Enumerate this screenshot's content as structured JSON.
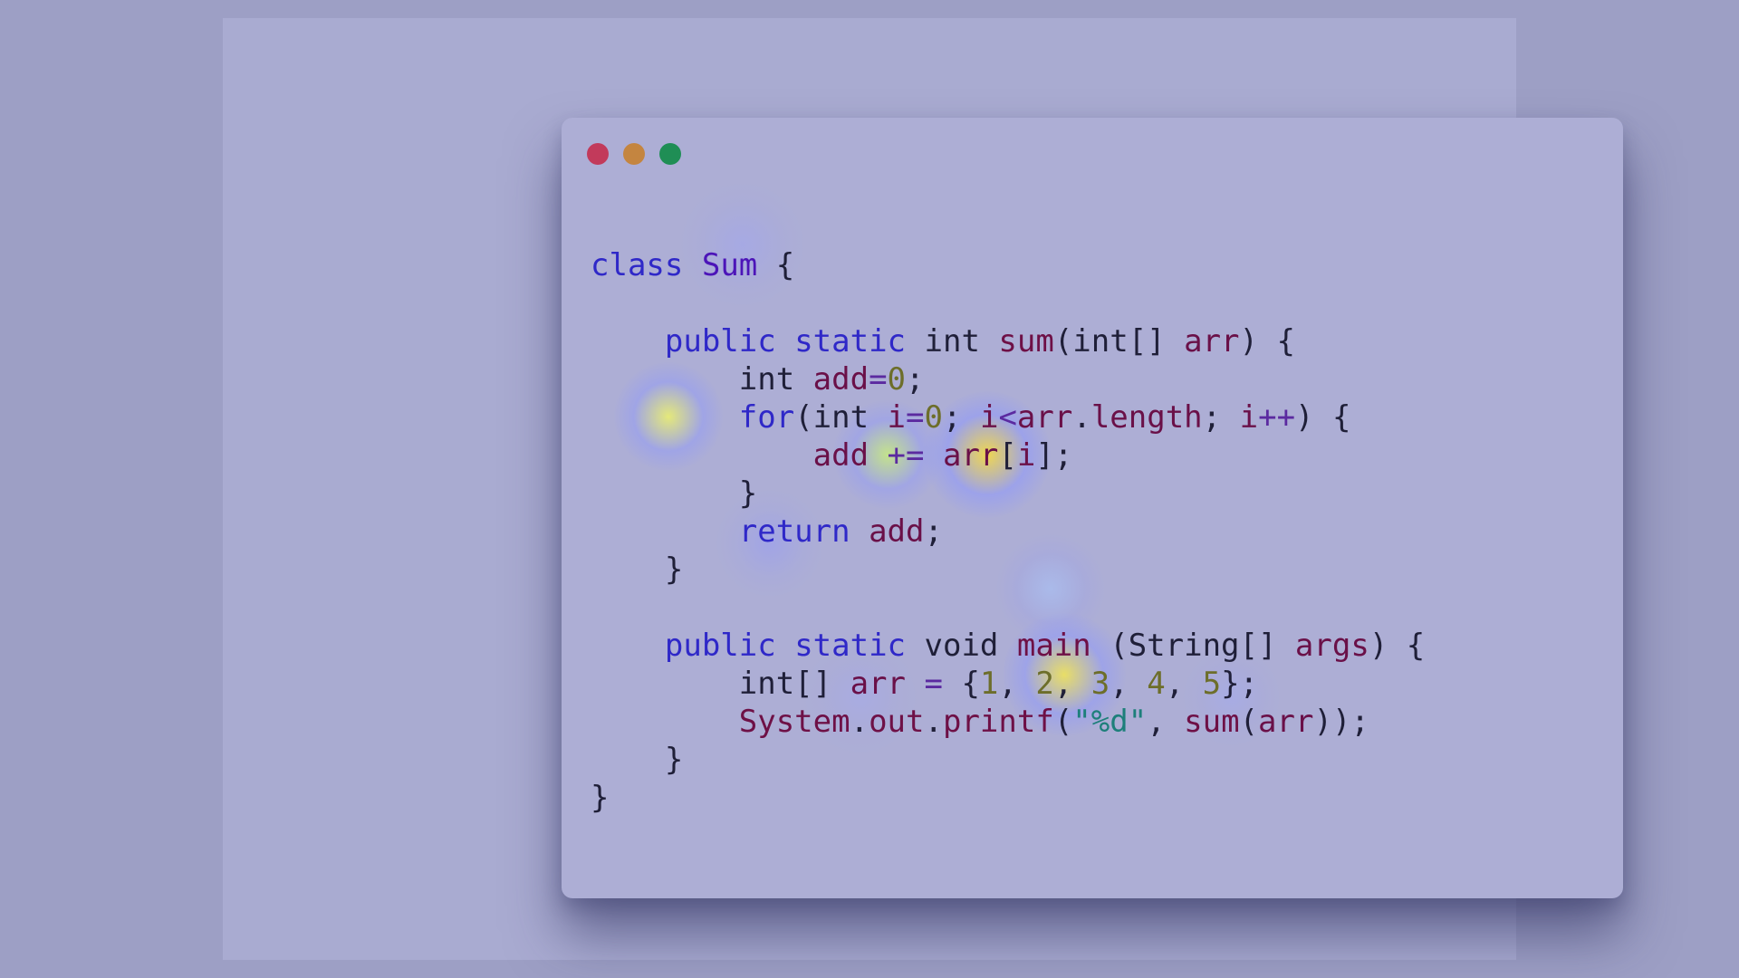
{
  "window": {
    "controls": [
      {
        "name": "close-button",
        "color": "#c23a5b"
      },
      {
        "name": "minimize-button",
        "color": "#c48540"
      },
      {
        "name": "maximize-button",
        "color": "#1f8e55"
      }
    ]
  },
  "code": {
    "lines": [
      [
        [
          "kw",
          "class"
        ],
        [
          "pl",
          " "
        ],
        [
          "cls",
          "Sum"
        ],
        [
          "pl",
          " {"
        ]
      ],
      [],
      [
        [
          "pl",
          "    "
        ],
        [
          "kw",
          "public"
        ],
        [
          "pl",
          " "
        ],
        [
          "kw",
          "static"
        ],
        [
          "pl",
          " int "
        ],
        [
          "fn",
          "sum"
        ],
        [
          "pl",
          "(int[] "
        ],
        [
          "id",
          "arr"
        ],
        [
          "pl",
          ") {"
        ]
      ],
      [
        [
          "pl",
          "        int "
        ],
        [
          "id",
          "add"
        ],
        [
          "op",
          "="
        ],
        [
          "num",
          "0"
        ],
        [
          "pl",
          ";"
        ]
      ],
      [
        [
          "pl",
          "        "
        ],
        [
          "kw",
          "for"
        ],
        [
          "pl",
          "(int "
        ],
        [
          "id",
          "i"
        ],
        [
          "op",
          "="
        ],
        [
          "num",
          "0"
        ],
        [
          "pl",
          "; "
        ],
        [
          "id",
          "i"
        ],
        [
          "op",
          "<"
        ],
        [
          "id",
          "arr"
        ],
        [
          "pl",
          "."
        ],
        [
          "id",
          "length"
        ],
        [
          "pl",
          "; "
        ],
        [
          "id",
          "i"
        ],
        [
          "op",
          "++"
        ],
        [
          "pl",
          ") {"
        ]
      ],
      [
        [
          "pl",
          "            "
        ],
        [
          "id",
          "add"
        ],
        [
          "pl",
          " "
        ],
        [
          "op",
          "+="
        ],
        [
          "pl",
          " "
        ],
        [
          "id",
          "arr"
        ],
        [
          "pl",
          "["
        ],
        [
          "id",
          "i"
        ],
        [
          "pl",
          "];"
        ]
      ],
      [
        [
          "pl",
          "        }"
        ]
      ],
      [
        [
          "pl",
          "        "
        ],
        [
          "kw",
          "return"
        ],
        [
          "pl",
          " "
        ],
        [
          "id",
          "add"
        ],
        [
          "pl",
          ";"
        ]
      ],
      [
        [
          "pl",
          "    }"
        ]
      ],
      [],
      [
        [
          "pl",
          "    "
        ],
        [
          "kw",
          "public"
        ],
        [
          "pl",
          " "
        ],
        [
          "kw",
          "static"
        ],
        [
          "pl",
          " void "
        ],
        [
          "fn",
          "main"
        ],
        [
          "pl",
          " (String[] "
        ],
        [
          "id",
          "args"
        ],
        [
          "pl",
          ") {"
        ]
      ],
      [
        [
          "pl",
          "        int[] "
        ],
        [
          "id",
          "arr"
        ],
        [
          "pl",
          " "
        ],
        [
          "op",
          "="
        ],
        [
          "pl",
          " {"
        ],
        [
          "num",
          "1"
        ],
        [
          "pl",
          ", "
        ],
        [
          "num",
          "2"
        ],
        [
          "pl",
          ", "
        ],
        [
          "num",
          "3"
        ],
        [
          "pl",
          ", "
        ],
        [
          "num",
          "4"
        ],
        [
          "pl",
          ", "
        ],
        [
          "num",
          "5"
        ],
        [
          "pl",
          "};"
        ]
      ],
      [
        [
          "pl",
          "        "
        ],
        [
          "fn",
          "System"
        ],
        [
          "pl",
          "."
        ],
        [
          "fn",
          "out"
        ],
        [
          "pl",
          "."
        ],
        [
          "fn",
          "printf"
        ],
        [
          "pl",
          "("
        ],
        [
          "str",
          "\"%d\""
        ],
        [
          "pl",
          ", "
        ],
        [
          "fn",
          "sum"
        ],
        [
          "pl",
          "("
        ],
        [
          "id",
          "arr"
        ],
        [
          "pl",
          "));"
        ]
      ],
      [
        [
          "pl",
          "    }"
        ]
      ],
      [
        [
          "pl",
          "}"
        ]
      ]
    ]
  },
  "heatmap": {
    "spots": [
      {
        "token": "for",
        "color": "#eef36a",
        "intensity": 0.85
      },
      {
        "token": "arr[i]",
        "color": "#f2d84a",
        "intensity": 0.95
      },
      {
        "token": "+=",
        "color": "#c9ef7a",
        "intensity": 0.8
      },
      {
        "token": "3",
        "color": "#efe35a",
        "intensity": 0.9
      },
      {
        "token": "class",
        "color": "#9aa0ff",
        "intensity": 0.35
      },
      {
        "token": "return",
        "color": "#8f95ff",
        "intensity": 0.4
      },
      {
        "token": "main",
        "color": "#a7c6ff",
        "intensity": 0.5
      },
      {
        "token": "sum(arr)",
        "color": "#9ea6ff",
        "intensity": 0.35
      },
      {
        "token": "printf",
        "color": "#9ea6ff",
        "intensity": 0.3
      }
    ]
  }
}
